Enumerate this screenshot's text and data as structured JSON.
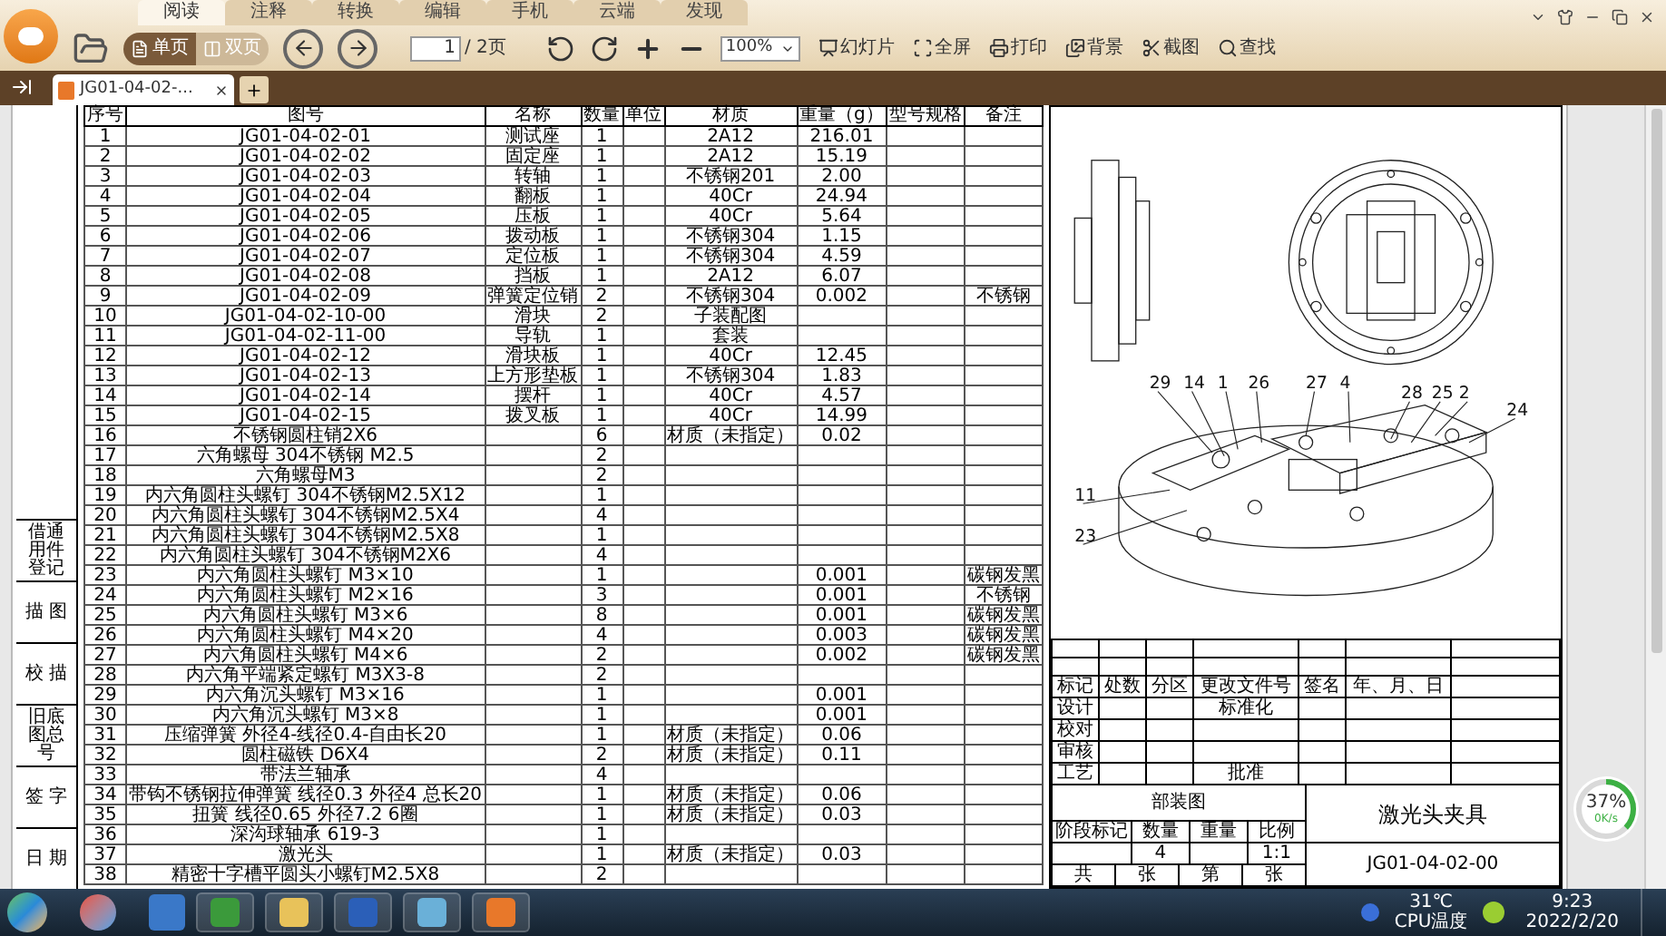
{
  "app_tabs": [
    {
      "label": "阅读",
      "selected": true
    },
    {
      "label": "注释",
      "selected": false
    },
    {
      "label": "转换",
      "selected": false
    },
    {
      "label": "编辑",
      "selected": false
    },
    {
      "label": "手机",
      "selected": false
    },
    {
      "label": "云端",
      "selected": false
    },
    {
      "label": "发现",
      "selected": false
    }
  ],
  "toolbar": {
    "view_modes": [
      {
        "label": "单页",
        "selected": true
      },
      {
        "label": "双页",
        "selected": false
      }
    ],
    "page_input": "1",
    "page_total": "/ 2页",
    "zoom": "100%",
    "actions": [
      {
        "label": "幻灯片"
      },
      {
        "label": "全屏"
      },
      {
        "label": "打印"
      },
      {
        "label": "背景"
      },
      {
        "label": "截图"
      },
      {
        "label": "查找"
      }
    ]
  },
  "doc_tabs": [
    {
      "label": "JG01-04-02-...",
      "selected": true
    }
  ],
  "document": {
    "margin_labels": [
      "借通用件登记",
      "描 图",
      "校 描",
      "旧底图总号",
      "签 字",
      "日 期"
    ],
    "bom": {
      "columns": [
        "序号",
        "图号",
        "名称",
        "数量",
        "单位",
        "材质",
        "重量（g）",
        "型号规格",
        "备注"
      ],
      "rows": [
        {
          "no": "1",
          "drawing_no": "JG01-04-02-01",
          "name": "测试座",
          "qty": "1",
          "material": "2A12",
          "weight": "216.01"
        },
        {
          "no": "2",
          "drawing_no": "JG01-04-02-02",
          "name": "固定座",
          "qty": "1",
          "material": "2A12",
          "weight": "15.19"
        },
        {
          "no": "3",
          "drawing_no": "JG01-04-02-03",
          "name": "转轴",
          "qty": "1",
          "material": "不锈钢201",
          "weight": "2.00"
        },
        {
          "no": "4",
          "drawing_no": "JG01-04-02-04",
          "name": "翻板",
          "qty": "1",
          "material": "40Cr",
          "weight": "24.94"
        },
        {
          "no": "5",
          "drawing_no": "JG01-04-02-05",
          "name": "压板",
          "qty": "1",
          "material": "40Cr",
          "weight": "5.64"
        },
        {
          "no": "6",
          "drawing_no": "JG01-04-02-06",
          "name": "拨动板",
          "qty": "1",
          "material": "不锈钢304",
          "weight": "1.15"
        },
        {
          "no": "7",
          "drawing_no": "JG01-04-02-07",
          "name": "定位板",
          "qty": "1",
          "material": "不锈钢304",
          "weight": "4.59"
        },
        {
          "no": "8",
          "drawing_no": "JG01-04-02-08",
          "name": "挡板",
          "qty": "1",
          "material": "2A12",
          "weight": "6.07"
        },
        {
          "no": "9",
          "drawing_no": "JG01-04-02-09",
          "name": "弹簧定位销",
          "qty": "2",
          "material": "不锈钢304",
          "weight": "0.002",
          "remark": "不锈钢"
        },
        {
          "no": "10",
          "drawing_no": "JG01-04-02-10-00",
          "name": "滑块",
          "qty": "2",
          "material": "子装配图"
        },
        {
          "no": "11",
          "drawing_no": "JG01-04-02-11-00",
          "name": "导轨",
          "qty": "1",
          "material": "套装"
        },
        {
          "no": "12",
          "drawing_no": "JG01-04-02-12",
          "name": "滑块板",
          "qty": "1",
          "material": "40Cr",
          "weight": "12.45"
        },
        {
          "no": "13",
          "drawing_no": "JG01-04-02-13",
          "name": "上方形垫板",
          "qty": "1",
          "material": "不锈钢304",
          "weight": "1.83"
        },
        {
          "no": "14",
          "drawing_no": "JG01-04-02-14",
          "name": "摆杆",
          "qty": "1",
          "material": "40Cr",
          "weight": "4.57"
        },
        {
          "no": "15",
          "drawing_no": "JG01-04-02-15",
          "name": "拨叉板",
          "qty": "1",
          "material": "40Cr",
          "weight": "14.99"
        },
        {
          "no": "16",
          "drawing_no": "不锈钢圆柱销2X6",
          "qty": "6",
          "material": "材质（未指定）",
          "weight": "0.02"
        },
        {
          "no": "17",
          "drawing_no": "六角螺母 304不锈钢 M2.5",
          "qty": "2"
        },
        {
          "no": "18",
          "drawing_no": "六角螺母M3",
          "qty": "2"
        },
        {
          "no": "19",
          "drawing_no": "内六角圆柱头螺钉 304不锈钢M2.5X12",
          "qty": "1"
        },
        {
          "no": "20",
          "drawing_no": "内六角圆柱头螺钉 304不锈钢M2.5X4",
          "qty": "4"
        },
        {
          "no": "21",
          "drawing_no": "内六角圆柱头螺钉 304不锈钢M2.5X8",
          "qty": "1"
        },
        {
          "no": "22",
          "drawing_no": "内六角圆柱头螺钉 304不锈钢M2X6",
          "qty": "4"
        },
        {
          "no": "23",
          "drawing_no": "内六角圆柱头螺钉 M3×10",
          "qty": "1",
          "weight": "0.001",
          "remark": "碳钢发黑"
        },
        {
          "no": "24",
          "drawing_no": "内六角圆柱头螺钉 M2×16",
          "qty": "3",
          "weight": "0.001",
          "remark": "不锈钢"
        },
        {
          "no": "25",
          "drawing_no": "内六角圆柱头螺钉 M3×6",
          "qty": "8",
          "weight": "0.001",
          "remark": "碳钢发黑"
        },
        {
          "no": "26",
          "drawing_no": "内六角圆柱头螺钉 M4×20",
          "qty": "4",
          "weight": "0.003",
          "remark": "碳钢发黑"
        },
        {
          "no": "27",
          "drawing_no": "内六角圆柱头螺钉 M4×6",
          "qty": "2",
          "weight": "0.002",
          "remark": "碳钢发黑"
        },
        {
          "no": "28",
          "drawing_no": "内六角平端紧定螺钉 M3X3-8",
          "qty": "2"
        },
        {
          "no": "29",
          "drawing_no": "内六角沉头螺钉 M3×16",
          "qty": "1",
          "weight": "0.001"
        },
        {
          "no": "30",
          "drawing_no": "内六角沉头螺钉 M3×8",
          "qty": "1",
          "weight": "0.001"
        },
        {
          "no": "31",
          "drawing_no": "压缩弹簧 外径4-线径0.4-自由长20",
          "qty": "1",
          "material": "材质（未指定）",
          "weight": "0.06"
        },
        {
          "no": "32",
          "drawing_no": "圆柱磁铁 D6X4",
          "qty": "2",
          "material": "材质（未指定）",
          "weight": "0.11"
        },
        {
          "no": "33",
          "drawing_no": "带法兰轴承",
          "qty": "4"
        },
        {
          "no": "34",
          "drawing_no": "带钩不锈钢拉伸弹簧 线径0.3 外径4 总长20",
          "qty": "1",
          "material": "材质（未指定）",
          "weight": "0.06"
        },
        {
          "no": "35",
          "drawing_no": "扭簧 线径0.65 外径7.2 6圈",
          "qty": "1",
          "material": "材质（未指定）",
          "weight": "0.03"
        },
        {
          "no": "36",
          "drawing_no": "深沟球轴承 619-3",
          "qty": "1"
        },
        {
          "no": "37",
          "drawing_no": "激光头",
          "qty": "1",
          "material": "材质（未指定）",
          "weight": "0.03"
        },
        {
          "no": "38",
          "drawing_no": "精密十字槽平圆头小螺钉M2.5X8",
          "qty": "2"
        }
      ]
    },
    "balloons": [
      "29",
      "14",
      "1",
      "26",
      "27",
      "4",
      "28",
      "25",
      "2",
      "24",
      "11",
      "23"
    ],
    "title_block": {
      "change_headers": [
        "标记",
        "处数",
        "分区",
        "更改文件号",
        "签名",
        "年、月、日"
      ],
      "sign_rows": [
        "设计",
        "校对",
        "审核",
        "工艺"
      ],
      "standardization": "标准化",
      "approval": "批准",
      "drawing_type": "部装图",
      "stage_headers": [
        "阶段标记",
        "数量",
        "重量",
        "比例"
      ],
      "quantity": "4",
      "scale": "1:1",
      "sheet_labels": [
        "共",
        "张",
        "第",
        "张"
      ],
      "part_name": "激光头夹具",
      "drawing_number": "JG01-04-02-00"
    }
  },
  "speed_badge": {
    "percent": "37%",
    "rate": "0K/s",
    "level": 0.37
  },
  "taskbar": {
    "temperature": "31℃",
    "temperature_label": "CPU温度",
    "time": "9:23",
    "date": "2022/2/20"
  }
}
